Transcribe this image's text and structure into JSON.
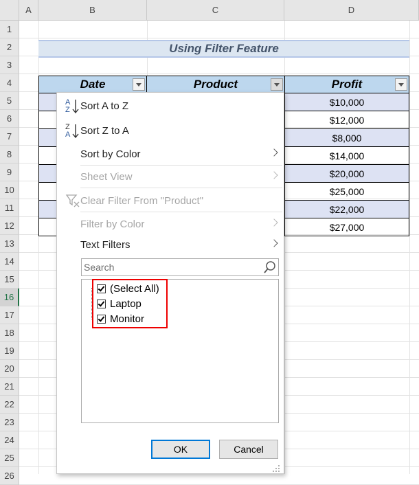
{
  "columns": [
    "A",
    "B",
    "C",
    "D"
  ],
  "rows": [
    "1",
    "2",
    "3",
    "4",
    "5",
    "6",
    "7",
    "8",
    "9",
    "10",
    "11",
    "12",
    "13",
    "14",
    "15",
    "16",
    "17",
    "18",
    "19",
    "20",
    "21",
    "22",
    "23",
    "24",
    "25",
    "26"
  ],
  "active_row": "16",
  "title": "Using Filter Feature",
  "table": {
    "headers": [
      "Date",
      "Product",
      "Profit"
    ],
    "profits": [
      "$10,000",
      "$12,000",
      "$8,000",
      "$14,000",
      "$20,000",
      "$25,000",
      "$22,000",
      "$27,000"
    ]
  },
  "menu": {
    "sort_az": "Sort A to Z",
    "sort_za": "Sort Z to A",
    "sort_color": "Sort by Color",
    "sheet_view": "Sheet View",
    "clear_filter": "Clear Filter From \"Product\"",
    "filter_color": "Filter by Color",
    "text_filters": "Text Filters",
    "search_placeholder": "Search",
    "items": [
      "(Select All)",
      "Laptop",
      "Monitor"
    ],
    "ok": "OK",
    "cancel": "Cancel"
  },
  "icons": {
    "sort_az_letters": "AZ",
    "sort_za_letters": "ZA"
  },
  "colors": {
    "header_fill": "#bdd7ee",
    "band_fill": "#dde2f3",
    "title_fill": "#dce6f1",
    "highlight_box": "#ee0000"
  }
}
